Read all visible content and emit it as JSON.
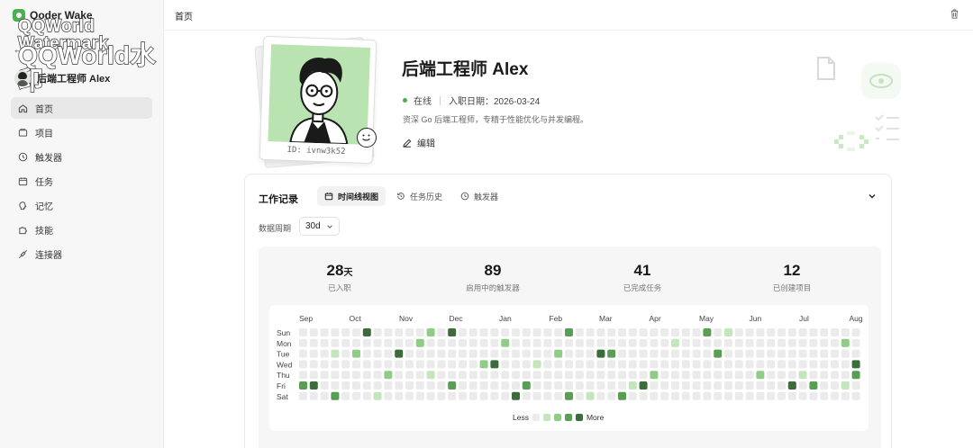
{
  "app": {
    "brand": "Qoder Wake",
    "watermark_line1": "QQWorld Watermark",
    "watermark_line2": "QQWorld水印"
  },
  "sidebar": {
    "user_name": "后端工程师 Alex",
    "items": [
      {
        "label": "首页",
        "icon": "home-icon",
        "active": true
      },
      {
        "label": "项目",
        "icon": "folder-icon",
        "active": false
      },
      {
        "label": "触发器",
        "icon": "clock-icon",
        "active": false
      },
      {
        "label": "任务",
        "icon": "calendar-icon",
        "active": false
      },
      {
        "label": "记忆",
        "icon": "brain-icon",
        "active": false
      },
      {
        "label": "技能",
        "icon": "puzzle-icon",
        "active": false
      },
      {
        "label": "连接器",
        "icon": "plug-icon",
        "active": false
      }
    ]
  },
  "topbar": {
    "breadcrumb": "首页",
    "trash_icon": "trash-icon"
  },
  "profile": {
    "name": "后端工程师 Alex",
    "status": "在线",
    "join_date": "入职日期：2026-03-24",
    "bio": "资深 Go 后端工程师，专精于性能优化与并发编程。",
    "edit_label": "编辑",
    "polaroid_id": "ID: ivnw3k52"
  },
  "work_record": {
    "title": "工作记录",
    "tabs": [
      {
        "label": "时间线视图",
        "icon": "calendar-icon",
        "active": true
      },
      {
        "label": "任务历史",
        "icon": "history-icon",
        "active": false
      },
      {
        "label": "触发器",
        "icon": "clock-icon",
        "active": false
      }
    ],
    "period_label": "数据周期",
    "period_value": "30d",
    "stats": [
      {
        "value": "28",
        "unit": "天",
        "label": "已入职"
      },
      {
        "value": "89",
        "unit": "",
        "label": "启用中的触发器"
      },
      {
        "value": "41",
        "unit": "",
        "label": "已完成任务"
      },
      {
        "value": "12",
        "unit": "",
        "label": "已创建项目"
      }
    ],
    "heatmap": {
      "months": [
        "Sep",
        "Oct",
        "Nov",
        "Dec",
        "Jan",
        "Feb",
        "Mar",
        "Apr",
        "May",
        "Jun",
        "Jul",
        "Aug"
      ],
      "days": [
        "Sun",
        "Mon",
        "Tue",
        "Wed",
        "Thu",
        "Fri",
        "Sat"
      ],
      "legend_less": "Less",
      "legend_more": "More",
      "colors": [
        "#ebebeb",
        "#c5e6bc",
        "#8fcc85",
        "#5a9e56",
        "#3e6b3c"
      ],
      "cells": [
        {
          "c": 6,
          "r": 0,
          "l": 4
        },
        {
          "c": 12,
          "r": 0,
          "l": 2
        },
        {
          "c": 14,
          "r": 0,
          "l": 4
        },
        {
          "c": 25,
          "r": 0,
          "l": 3
        },
        {
          "c": 38,
          "r": 0,
          "l": 3
        },
        {
          "c": 40,
          "r": 0,
          "l": 1
        },
        {
          "c": 11,
          "r": 1,
          "l": 2
        },
        {
          "c": 19,
          "r": 1,
          "l": 2
        },
        {
          "c": 35,
          "r": 1,
          "l": 1
        },
        {
          "c": 51,
          "r": 1,
          "l": 2
        },
        {
          "c": 3,
          "r": 2,
          "l": 1
        },
        {
          "c": 5,
          "r": 2,
          "l": 2
        },
        {
          "c": 9,
          "r": 2,
          "l": 4
        },
        {
          "c": 24,
          "r": 2,
          "l": 2
        },
        {
          "c": 28,
          "r": 2,
          "l": 4
        },
        {
          "c": 29,
          "r": 2,
          "l": 3
        },
        {
          "c": 39,
          "r": 2,
          "l": 3
        },
        {
          "c": 17,
          "r": 3,
          "l": 2
        },
        {
          "c": 18,
          "r": 3,
          "l": 4
        },
        {
          "c": 22,
          "r": 3,
          "l": 1
        },
        {
          "c": 52,
          "r": 3,
          "l": 4
        },
        {
          "c": 8,
          "r": 4,
          "l": 2
        },
        {
          "c": 12,
          "r": 4,
          "l": 1
        },
        {
          "c": 33,
          "r": 4,
          "l": 2
        },
        {
          "c": 43,
          "r": 4,
          "l": 2
        },
        {
          "c": 47,
          "r": 4,
          "l": 1
        },
        {
          "c": 52,
          "r": 4,
          "l": 3
        },
        {
          "c": 0,
          "r": 5,
          "l": 3
        },
        {
          "c": 1,
          "r": 5,
          "l": 4
        },
        {
          "c": 14,
          "r": 5,
          "l": 3
        },
        {
          "c": 21,
          "r": 5,
          "l": 3
        },
        {
          "c": 31,
          "r": 5,
          "l": 1
        },
        {
          "c": 32,
          "r": 5,
          "l": 4
        },
        {
          "c": 46,
          "r": 5,
          "l": 4
        },
        {
          "c": 48,
          "r": 5,
          "l": 3
        },
        {
          "c": 51,
          "r": 5,
          "l": 1
        },
        {
          "c": 3,
          "r": 6,
          "l": 3
        },
        {
          "c": 7,
          "r": 6,
          "l": 1
        },
        {
          "c": 20,
          "r": 6,
          "l": 4
        },
        {
          "c": 25,
          "r": 6,
          "l": 3
        },
        {
          "c": 27,
          "r": 6,
          "l": 1
        },
        {
          "c": 30,
          "r": 6,
          "l": 3
        }
      ]
    }
  }
}
